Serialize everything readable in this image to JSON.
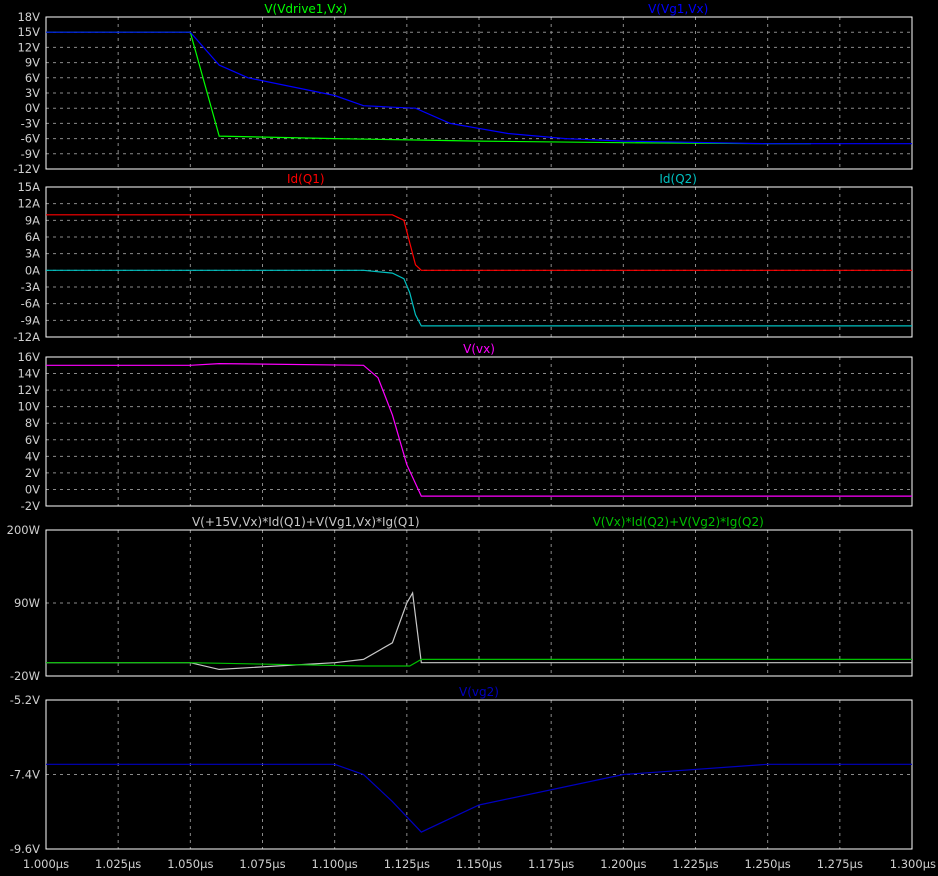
{
  "chart_data": [
    {
      "type": "line",
      "ylim": [
        -12,
        18
      ],
      "yticks": [
        "18V",
        "15V",
        "12V",
        "9V",
        "6V",
        "3V",
        "0V",
        "-3V",
        "-6V",
        "-9V",
        "-12V"
      ],
      "legend_align": "labels above plot, one per trace",
      "series": [
        {
          "name": "V(Vdrive1,Vx)",
          "color": "#00ff00",
          "label_pos": "left",
          "x": [
            1.0,
            1.05,
            1.06,
            1.1,
            1.15,
            1.2,
            1.25,
            1.265
          ],
          "y": [
            15,
            15,
            -5.5,
            -6,
            -6.5,
            -6.8,
            -7,
            -7
          ]
        },
        {
          "name": "V(Vg1,Vx)",
          "color": "#0000ff",
          "label_pos": "right",
          "x": [
            1.0,
            1.05,
            1.06,
            1.07,
            1.1,
            1.11,
            1.12,
            1.128,
            1.14,
            1.16,
            1.18,
            1.2,
            1.25,
            1.3
          ],
          "y": [
            15,
            15,
            8.5,
            6,
            2.5,
            0.5,
            0.2,
            0,
            -3,
            -5,
            -6,
            -6.5,
            -7,
            -7
          ]
        }
      ]
    },
    {
      "type": "line",
      "ylim": [
        -12,
        15
      ],
      "yticks": [
        "15A",
        "12A",
        "9A",
        "6A",
        "3A",
        "0A",
        "-3A",
        "-6A",
        "-9A",
        "-12A"
      ],
      "series": [
        {
          "name": "Id(Q1)",
          "color": "#ff0000",
          "label_pos": "left",
          "x": [
            1.0,
            1.12,
            1.124,
            1.126,
            1.128,
            1.13,
            1.3
          ],
          "y": [
            10,
            10,
            9,
            5,
            1,
            0,
            0
          ]
        },
        {
          "name": "Id(Q2)",
          "color": "#00c0c0",
          "label_pos": "right",
          "x": [
            1.0,
            1.11,
            1.12,
            1.124,
            1.126,
            1.128,
            1.13,
            1.3
          ],
          "y": [
            0,
            0,
            -0.5,
            -1.5,
            -4,
            -8,
            -10,
            -10
          ]
        }
      ]
    },
    {
      "type": "line",
      "ylim": [
        -2,
        16
      ],
      "yticks": [
        "16V",
        "14V",
        "12V",
        "10V",
        "8V",
        "6V",
        "4V",
        "2V",
        "0V",
        "-2V"
      ],
      "series": [
        {
          "name": "V(vx)",
          "color": "#ff00ff",
          "label_pos": "center",
          "x": [
            1.0,
            1.05,
            1.06,
            1.11,
            1.115,
            1.12,
            1.125,
            1.13,
            1.3
          ],
          "y": [
            15,
            15,
            15.2,
            15,
            13.5,
            9,
            3,
            -0.8,
            -0.8
          ]
        }
      ]
    },
    {
      "type": "line",
      "ylim": [
        -20,
        200
      ],
      "yticks": [
        "200W",
        "90W",
        "-20W"
      ],
      "series": [
        {
          "name": "V(+15V,Vx)*Id(Q1)+V(Vg1,Vx)*Ig(Q1)",
          "color": "#c8c8c8",
          "label_pos": "left",
          "x": [
            1.0,
            1.05,
            1.06,
            1.08,
            1.1,
            1.11,
            1.12,
            1.125,
            1.127,
            1.13,
            1.3
          ],
          "y": [
            0,
            0,
            -10,
            -5,
            0,
            5,
            30,
            90,
            105,
            0,
            0
          ]
        },
        {
          "name": "V(Vx)*Id(Q2)+V(Vg2)*Ig(Q2)",
          "color": "#00c000",
          "label_pos": "right",
          "x": [
            1.0,
            1.05,
            1.11,
            1.126,
            1.13,
            1.3
          ],
          "y": [
            0,
            0,
            -5,
            -5,
            5,
            5
          ]
        }
      ]
    },
    {
      "type": "line",
      "ylim": [
        -9.6,
        -5.2
      ],
      "yticks": [
        "-5.2V",
        "-7.4V",
        "-9.6V"
      ],
      "series": [
        {
          "name": "V(vg2)",
          "color": "#0000c0",
          "label_pos": "center",
          "x": [
            1.0,
            1.1,
            1.11,
            1.12,
            1.13,
            1.15,
            1.2,
            1.25,
            1.3
          ],
          "y": [
            -7.1,
            -7.1,
            -7.4,
            -8.2,
            -9.1,
            -8.3,
            -7.4,
            -7.1,
            -7.1
          ]
        }
      ]
    }
  ],
  "x_axis": {
    "xlim": [
      1.0,
      1.3
    ],
    "ticks": [
      "1.000µs",
      "1.025µs",
      "1.050µs",
      "1.075µs",
      "1.100µs",
      "1.125µs",
      "1.150µs",
      "1.175µs",
      "1.200µs",
      "1.225µs",
      "1.250µs",
      "1.275µs",
      "1.300µs"
    ]
  },
  "grid": true
}
